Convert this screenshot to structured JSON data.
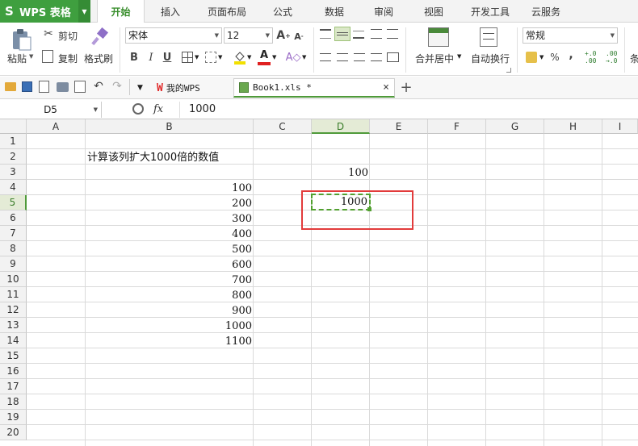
{
  "app": {
    "name": "WPS 表格",
    "logo_letter": "S"
  },
  "menu_tabs": [
    "开始",
    "插入",
    "页面布局",
    "公式",
    "数据",
    "审阅",
    "视图",
    "开发工具",
    "云服务"
  ],
  "active_tab": "开始",
  "ribbon": {
    "paste": "粘贴",
    "cut": "剪切",
    "copy": "复制",
    "format_painter": "格式刷",
    "font_name": "宋体",
    "font_size": "12",
    "bold": "B",
    "italic": "I",
    "underline": "U",
    "font_color_glyph": "A",
    "merge_center": "合并居中",
    "wrap_text": "自动换行",
    "number_format": "常规",
    "percent": "%",
    "comma": ",",
    "inc_decimal": "+.0 .00",
    "dec_decimal": ".00 →.0",
    "truncated": "条"
  },
  "quickbar": {
    "wps_tab": "我的WPS",
    "book_tab": "Book1.xls *",
    "close_glyph": "×",
    "add_glyph": "+"
  },
  "formula_bar": {
    "name_box": "D5",
    "fx": "fx",
    "value": "1000"
  },
  "sheet": {
    "columns": [
      "A",
      "B",
      "C",
      "D",
      "E",
      "F",
      "G",
      "H",
      "I"
    ],
    "rows": [
      "1",
      "2",
      "3",
      "4",
      "5",
      "6",
      "7",
      "8",
      "9",
      "10",
      "11",
      "12",
      "13",
      "14",
      "15",
      "16",
      "17",
      "18",
      "19",
      "20"
    ],
    "selected_col": "D",
    "selected_row": "5",
    "b2_text": "计算该列扩大1000倍的数值",
    "d3": "100",
    "d5": "1000",
    "b_values": [
      "100",
      "200",
      "300",
      "400",
      "500",
      "600",
      "700",
      "800",
      "900",
      "1000",
      "1100"
    ]
  },
  "accent_colors": {
    "brand_green": "#3f9f3f",
    "selection_green": "#52a030",
    "highlight_red": "#e23b3b"
  }
}
